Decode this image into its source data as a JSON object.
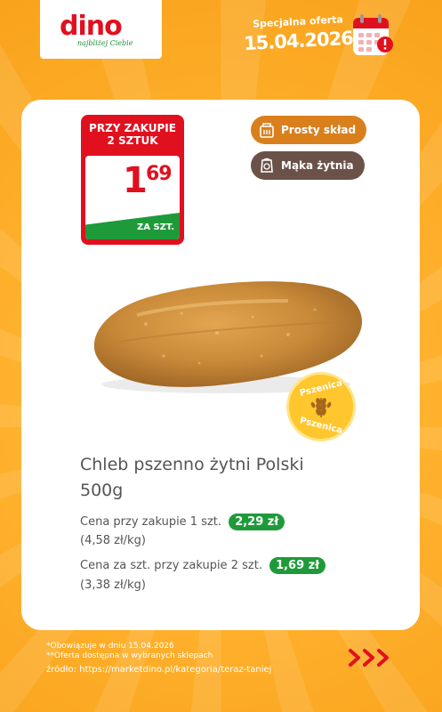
{
  "header": {
    "logo_word": "dino",
    "logo_tagline": "najbliżej Ciebie",
    "offer_label": "Specjalna oferta",
    "offer_date": "15.04.2026"
  },
  "colors": {
    "brand_red": "#e1101f",
    "brand_green": "#1f9a3a",
    "background_orange": "#ffb22e",
    "tag_orange": "#d9801d",
    "tag_brown": "#6b5248"
  },
  "price_badge": {
    "top_line1": "PRZY ZAKUPIE",
    "top_line2": "2 SZTUK",
    "price_int": "1",
    "price_dec": "69",
    "unit": "ZA SZT."
  },
  "tags": [
    {
      "label": "Prosty skład",
      "icon": "paper-bag-icon"
    },
    {
      "label": "Mąka żytnia",
      "icon": "flour-sack-icon"
    }
  ],
  "seal": {
    "text_top": "Pszenica",
    "text_bottom": "Pszenica",
    "icon": "wheat-icon"
  },
  "product": {
    "title": "Chleb pszenno żytni Polski 500g",
    "single_label": "Cena przy zakupie 1 szt.",
    "single_price": "2,29 zł",
    "single_unit": "(4,58 zł/kg)",
    "double_label": "Cena za szt. przy zakupie 2 szt.",
    "double_price": "1,69 zł",
    "double_unit": "(3,38 zł/kg)"
  },
  "footer": {
    "note1": "*Obowiązuje w dniu 15.04.2026",
    "note2": "**Oferta dostępna w wybranych sklepach",
    "source": "źródło: https://marketdino.pl/kategoria/teraz-taniej"
  }
}
